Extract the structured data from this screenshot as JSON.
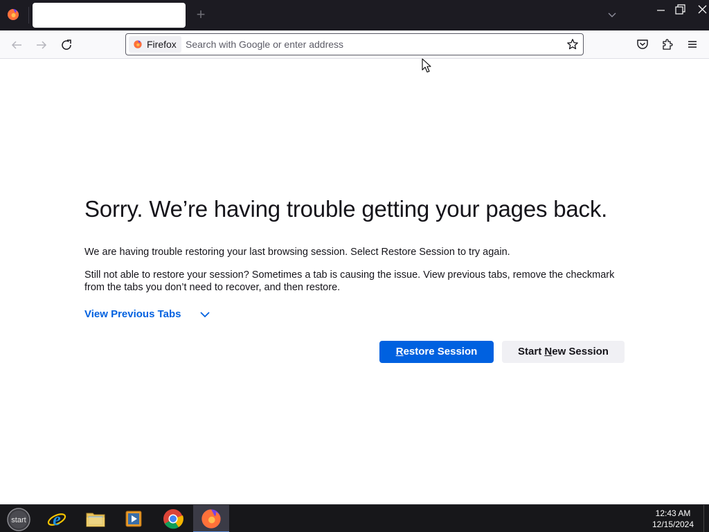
{
  "tabstrip": {
    "active_tab_title": "",
    "new_tab_symbol": "+"
  },
  "navbar": {
    "identity_label": "Firefox",
    "url_placeholder": "Search with Google or enter address",
    "url_value": ""
  },
  "content": {
    "heading": "Sorry. We’re having trouble getting your pages back.",
    "para1": "We are having trouble restoring your last browsing session. Select Restore Session to try again.",
    "para2": "Still not able to restore your session? Sometimes a tab is causing the issue. View previous tabs, remove the checkmark from the tabs you don’t need to recover, and then restore.",
    "view_previous_tabs": "View Previous Tabs",
    "restore_button": {
      "accesskey": "R",
      "rest": "estore Session"
    },
    "new_session_button": {
      "before": "Start ",
      "accesskey": "N",
      "after": "ew Session"
    }
  },
  "taskbar": {
    "start_label": "start",
    "clock_time": "12:43 AM",
    "clock_date": "12/15/2024"
  },
  "icons": {
    "back": "arrow-left-icon",
    "forward": "arrow-right-icon",
    "reload": "reload-icon",
    "bookmark": "star-icon",
    "pocket": "pocket-icon",
    "extensions": "puzzle-icon",
    "menu": "hamburger-icon"
  },
  "colors": {
    "accent": "#0061e0",
    "tabstrip_bg": "#1c1b22",
    "navbar_bg": "#f9f9fb",
    "taskbar_bg": "#17171a"
  }
}
